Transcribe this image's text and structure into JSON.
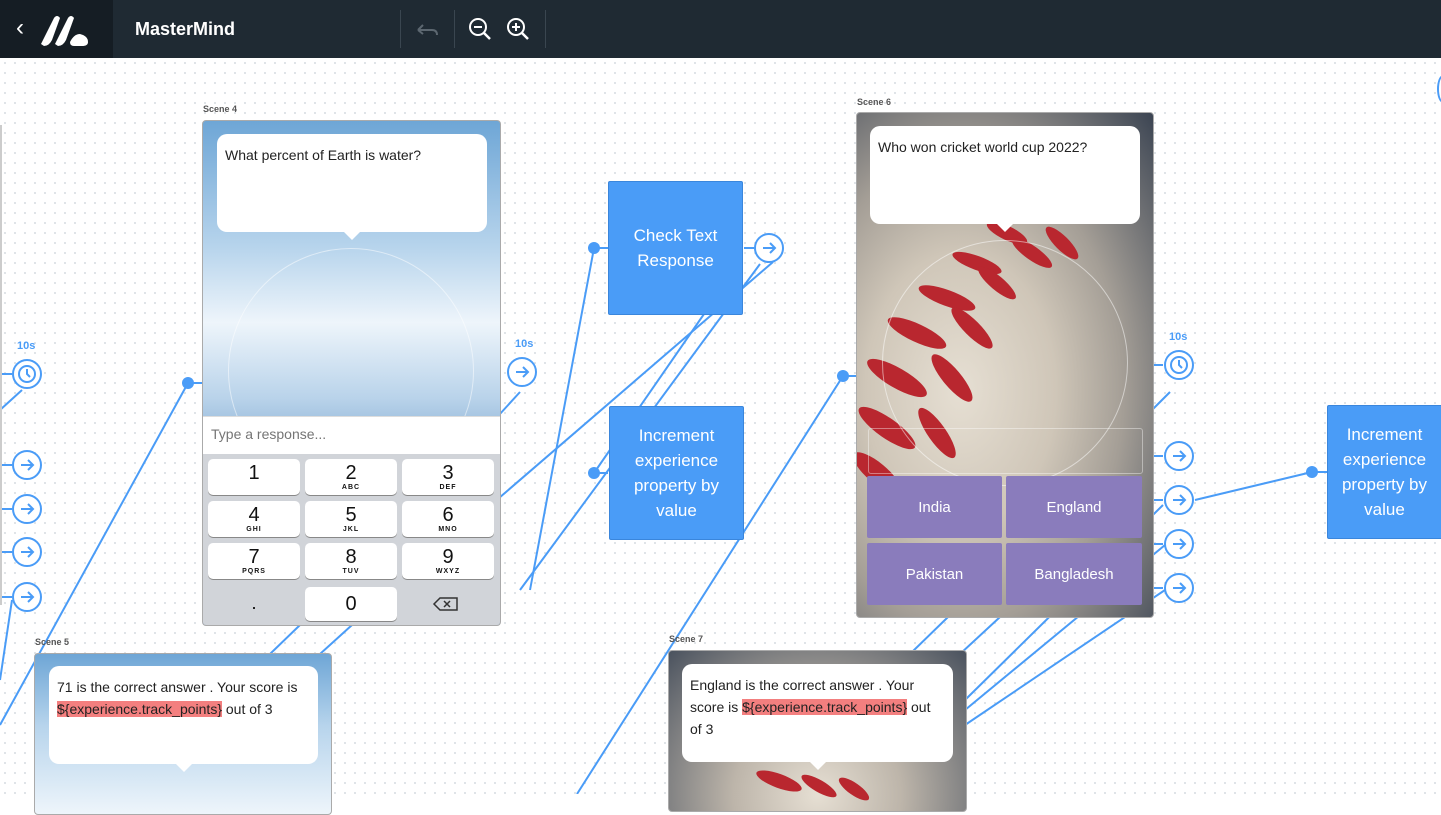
{
  "header": {
    "app_title": "MasterMind",
    "back_icon": "chevron-left-icon",
    "undo_icon": "undo-icon",
    "zoom_out_icon": "zoom-out-icon",
    "zoom_in_icon": "zoom-in-icon"
  },
  "scene4": {
    "label": "Scene 4",
    "question": "What percent of Earth is water?",
    "input_placeholder": "Type a response...",
    "keys": [
      {
        "num": "1",
        "sub": ""
      },
      {
        "num": "2",
        "sub": "ABC"
      },
      {
        "num": "3",
        "sub": "DEF"
      },
      {
        "num": "4",
        "sub": "GHI"
      },
      {
        "num": "5",
        "sub": "JKL"
      },
      {
        "num": "6",
        "sub": "MNO"
      },
      {
        "num": "7",
        "sub": "PQRS"
      },
      {
        "num": "8",
        "sub": "TUV"
      },
      {
        "num": "9",
        "sub": "WXYZ"
      }
    ],
    "key_dot": ".",
    "key_zero": "0",
    "timer": "10s"
  },
  "scene5": {
    "label": "Scene 5",
    "text_before": "71 is the correct answer . Your score is ",
    "variable": "${experience.track_points}",
    "text_after": " out of 3"
  },
  "scene6": {
    "label": "Scene 6",
    "question": "Who won cricket world cup 2022?",
    "answers": [
      "India",
      "England",
      "Pakistan",
      "Bangladesh"
    ],
    "timer": "10s"
  },
  "scene7": {
    "label": "Scene 7",
    "text_before": "England is the correct answer . Your score is ",
    "variable": "${experience.track_points}",
    "text_after": " out of 3"
  },
  "nodes": {
    "check_text": "Check Text Response",
    "increment_1": "Increment experience property by value",
    "increment_2": "Increment experience property by value"
  },
  "left_timer": "10s",
  "colors": {
    "accent": "#4a9cf7",
    "header_bg": "#1f2a33",
    "answer_bg": "#8a7cbc",
    "highlight": "#f37f7f"
  }
}
